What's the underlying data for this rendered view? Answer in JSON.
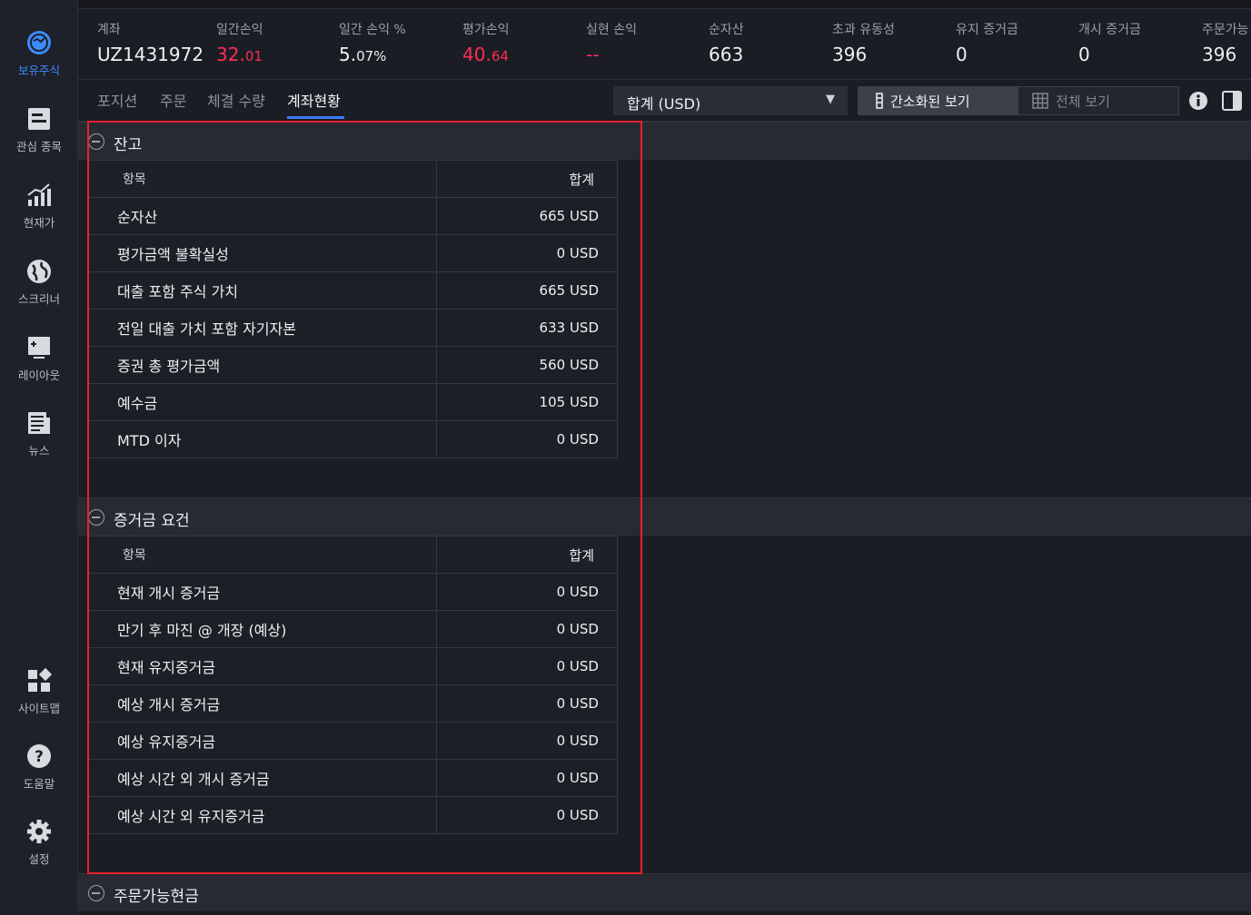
{
  "sidebar": {
    "items": [
      {
        "label": "보유주식",
        "icon": "portfolio-icon",
        "active": true
      },
      {
        "label": "관심 종목",
        "icon": "watchlist-icon"
      },
      {
        "label": "현재가",
        "icon": "quote-chart-icon"
      },
      {
        "label": "스크리너",
        "icon": "globe-icon"
      },
      {
        "label": "레이아웃",
        "icon": "layout-icon"
      },
      {
        "label": "뉴스",
        "icon": "news-icon"
      },
      {
        "label": "사이트맵",
        "icon": "sitemap-icon"
      },
      {
        "label": "도움말",
        "icon": "help-icon"
      },
      {
        "label": "설정",
        "icon": "settings-icon"
      }
    ]
  },
  "metrics": {
    "account": {
      "label": "계좌",
      "value": "UZ1431972"
    },
    "daily_pnl": {
      "label": "일간손익",
      "value_main": "32.",
      "value_small": "01"
    },
    "daily_pnl_pct": {
      "label": "일간 손익 %",
      "value_main": "5.",
      "value_small": "07%"
    },
    "unrealized_pnl": {
      "label": "평가손익",
      "value_main": "40.",
      "value_small": "64"
    },
    "realized_pnl": {
      "label": "실현 손익",
      "value": "--"
    },
    "net_assets": {
      "label": "순자산",
      "value": "663"
    },
    "excess_liquidity": {
      "label": "초과 유동성",
      "value": "396"
    },
    "maintenance_margin": {
      "label": "유지 증거금",
      "value": "0"
    },
    "initial_margin": {
      "label": "개시 증거금",
      "value": "0"
    },
    "buying_power": {
      "label": "주문가능",
      "value": "396"
    }
  },
  "tabs": {
    "items": [
      "포지션",
      "주문",
      "체결 수량",
      "계좌현황"
    ],
    "active_index": 3
  },
  "currency_select": {
    "value": "합계 (USD)"
  },
  "view_toggle": {
    "simple_label": "간소화된 보기",
    "full_label": "전체 보기"
  },
  "sections": {
    "balance": {
      "title": "잔고",
      "col_item": "항목",
      "col_total": "합계",
      "rows": [
        {
          "name": "순자산",
          "value": "665 USD"
        },
        {
          "name": "평가금액 불확실성",
          "value": "0 USD"
        },
        {
          "name": "대출 포함 주식 가치",
          "value": "665 USD"
        },
        {
          "name": "전일 대출 가치 포함 자기자본",
          "value": "633 USD"
        },
        {
          "name": "증권 총 평가금액",
          "value": "560 USD"
        },
        {
          "name": "예수금",
          "value": "105 USD"
        },
        {
          "name": "MTD 이자",
          "value": "0 USD"
        }
      ]
    },
    "margin": {
      "title": "증거금 요건",
      "col_item": "항목",
      "col_total": "합계",
      "rows": [
        {
          "name": "현재 개시 증거금",
          "value": "0 USD"
        },
        {
          "name": "만기 후 마진 @ 개장 (예상)",
          "value": "0 USD"
        },
        {
          "name": "현재 유지증거금",
          "value": "0 USD"
        },
        {
          "name": "예상 개시 증거금",
          "value": "0 USD"
        },
        {
          "name": "예상 유지증거금",
          "value": "0 USD"
        },
        {
          "name": "예상 시간 외 개시 증거금",
          "value": "0 USD"
        },
        {
          "name": "예상 시간 외 유지증거금",
          "value": "0 USD"
        }
      ]
    },
    "available_cash": {
      "title": "주문가능현금"
    }
  },
  "colors": {
    "accent": "#3d8bff",
    "negative": "#ff2d55",
    "highlight_box": "#e8202a"
  }
}
